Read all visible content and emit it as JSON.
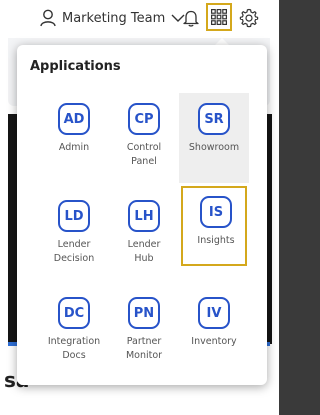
{
  "topbar": {
    "team_label": "Marketing Team",
    "icons": [
      "user-icon",
      "chevron-down-icon",
      "bell-icon",
      "apps-grid-icon",
      "gear-icon"
    ]
  },
  "background": {
    "partial_text": "sa"
  },
  "applications": {
    "title": "Applications",
    "apps": [
      {
        "abbr": "AD",
        "line1": "Admin",
        "line2": ""
      },
      {
        "abbr": "CP",
        "line1": "Control",
        "line2": "Panel"
      },
      {
        "abbr": "SR",
        "line1": "Showroom",
        "line2": ""
      },
      {
        "abbr": "LD",
        "line1": "Lender",
        "line2": "Decision"
      },
      {
        "abbr": "LH",
        "line1": "Lender",
        "line2": "Hub"
      },
      {
        "abbr": "IS",
        "line1": "Insights",
        "line2": ""
      },
      {
        "abbr": "DC",
        "line1": "Integration",
        "line2": "Docs"
      },
      {
        "abbr": "PN",
        "line1": "Partner",
        "line2": "Monitor"
      },
      {
        "abbr": "IV",
        "line1": "Inventory",
        "line2": ""
      }
    ]
  },
  "colors": {
    "accent": "#2753c9",
    "highlight": "#d4a81c",
    "active_tile": "#eeeeee"
  }
}
